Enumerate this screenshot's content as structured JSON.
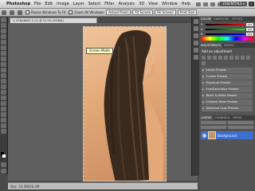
{
  "menubar": {
    "app_name": "Photoshop",
    "items": [
      "File",
      "Edit",
      "Image",
      "Layer",
      "Select",
      "Filter",
      "Analysis",
      "3D",
      "View",
      "Window",
      "Help"
    ],
    "workspace": "ESSENTIALS ▾"
  },
  "options_bar": {
    "size_label": "Size:",
    "check_label": "Resize Windows To Fit",
    "zoom_all_label": "Zoom All Windows",
    "buttons": [
      "Actual Pixels",
      "Fit Screen",
      "Fill Screen",
      "Print Size"
    ]
  },
  "document": {
    "tab_title": "SCN48652-2 (1) @ 12.5% (RGB/8)",
    "status_text": "Doc: 16.2M/16.2M",
    "tooltip": "Screen Mode"
  },
  "panels": {
    "color_tabs": [
      "COLOR",
      "SWATCHES",
      "STYLES"
    ],
    "color_channels": [
      {
        "label": "R",
        "value": "242"
      },
      {
        "label": "G",
        "value": "200"
      },
      {
        "label": "B",
        "value": "164"
      }
    ],
    "adjust_tabs": [
      "ADJUSTMENTS",
      "MASKS"
    ],
    "adjust_title": "Add an adjustment",
    "presets": [
      "Levels Presets",
      "Curves Presets",
      "Exposure Presets",
      "Hue/Saturation Presets",
      "Black & White Presets",
      "Channel Mixer Presets",
      "Selective Color Presets"
    ],
    "layer_tabs": [
      "LAYERS",
      "CHANNELS",
      "PATHS"
    ],
    "layer_name": "Background"
  },
  "colors": {
    "accent": "#3d6fd1",
    "hair": "#3a2a1e",
    "skin": "#e2a878"
  }
}
